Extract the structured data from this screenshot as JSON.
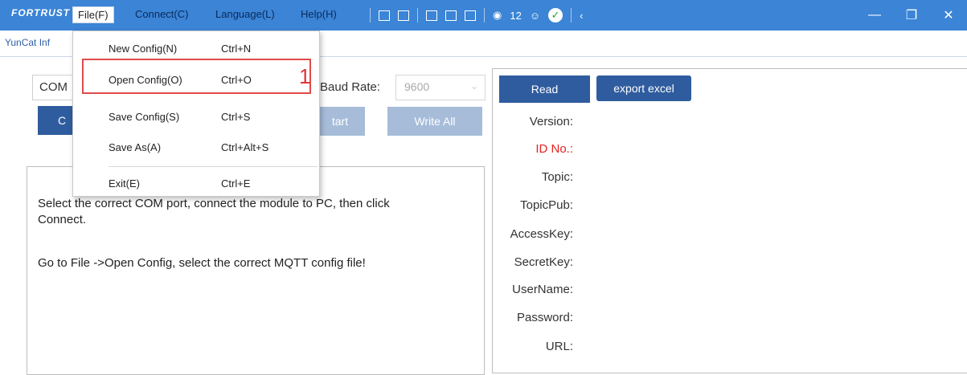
{
  "titlebar": {
    "logo": "FORTRUST",
    "menus": [
      "File(F)",
      "Connect(C)",
      "Language(L)",
      "Help(H)"
    ],
    "tray_count": "12",
    "colors": {
      "titlebar_bg": "#3b84d6",
      "accent": "#2f5c9e"
    }
  },
  "tab": {
    "label": "YunCat Inf"
  },
  "connection": {
    "com_value": "COM",
    "baud_label": "Baud Rate:",
    "baud_value": "9600",
    "connect_label": "C",
    "start_label": "tart",
    "write_all_label": "Write All"
  },
  "log": {
    "lines": [
      "Select the correct COM port, connect the module to PC, then click",
      "Connect.",
      "Go to File ->Open Config, select the correct MQTT config file!"
    ]
  },
  "right": {
    "read_label": "Read",
    "export_label": "export excel",
    "fields": [
      "Version:",
      "ID No.:",
      "Topic:",
      "TopicPub:",
      "AccessKey:",
      "SecretKey:",
      "UserName:",
      "Password:",
      "URL:"
    ]
  },
  "file_menu": {
    "items": [
      {
        "label": "New Config(N)",
        "shortcut": "Ctrl+N"
      },
      {
        "label": "Open Config(O)",
        "shortcut": "Ctrl+O"
      },
      {
        "label": "Save Config(S)",
        "shortcut": "Ctrl+S"
      },
      {
        "label": "Save As(A)",
        "shortcut": "Ctrl+Alt+S"
      },
      {
        "label": "Exit(E)",
        "shortcut": "Ctrl+E"
      }
    ],
    "annotation_number": "1"
  }
}
